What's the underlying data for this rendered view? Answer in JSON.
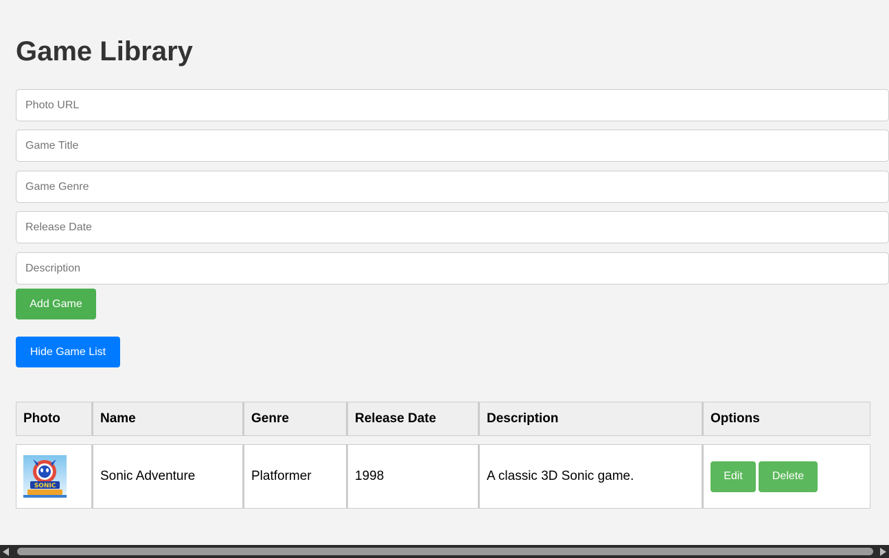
{
  "page_title": "Game Library",
  "form": {
    "photo_url_placeholder": "Photo URL",
    "title_placeholder": "Game Title",
    "genre_placeholder": "Game Genre",
    "release_date_placeholder": "Release Date",
    "description_placeholder": "Description",
    "add_button": "Add Game"
  },
  "toggle_list_button": "Hide Game List",
  "table": {
    "headers": [
      "Photo",
      "Name",
      "Genre",
      "Release Date",
      "Description",
      "Options"
    ],
    "rows": [
      {
        "photo": "Sonic Adventure cover art",
        "name": "Sonic Adventure",
        "genre": "Platformer",
        "release_date": "1998",
        "description": "A classic 3D Sonic game.",
        "edit_label": "Edit",
        "delete_label": "Delete"
      }
    ]
  },
  "colors": {
    "add_button": "#4caf50",
    "toggle_button": "#007bff",
    "row_buttons": "#5cb85c"
  }
}
